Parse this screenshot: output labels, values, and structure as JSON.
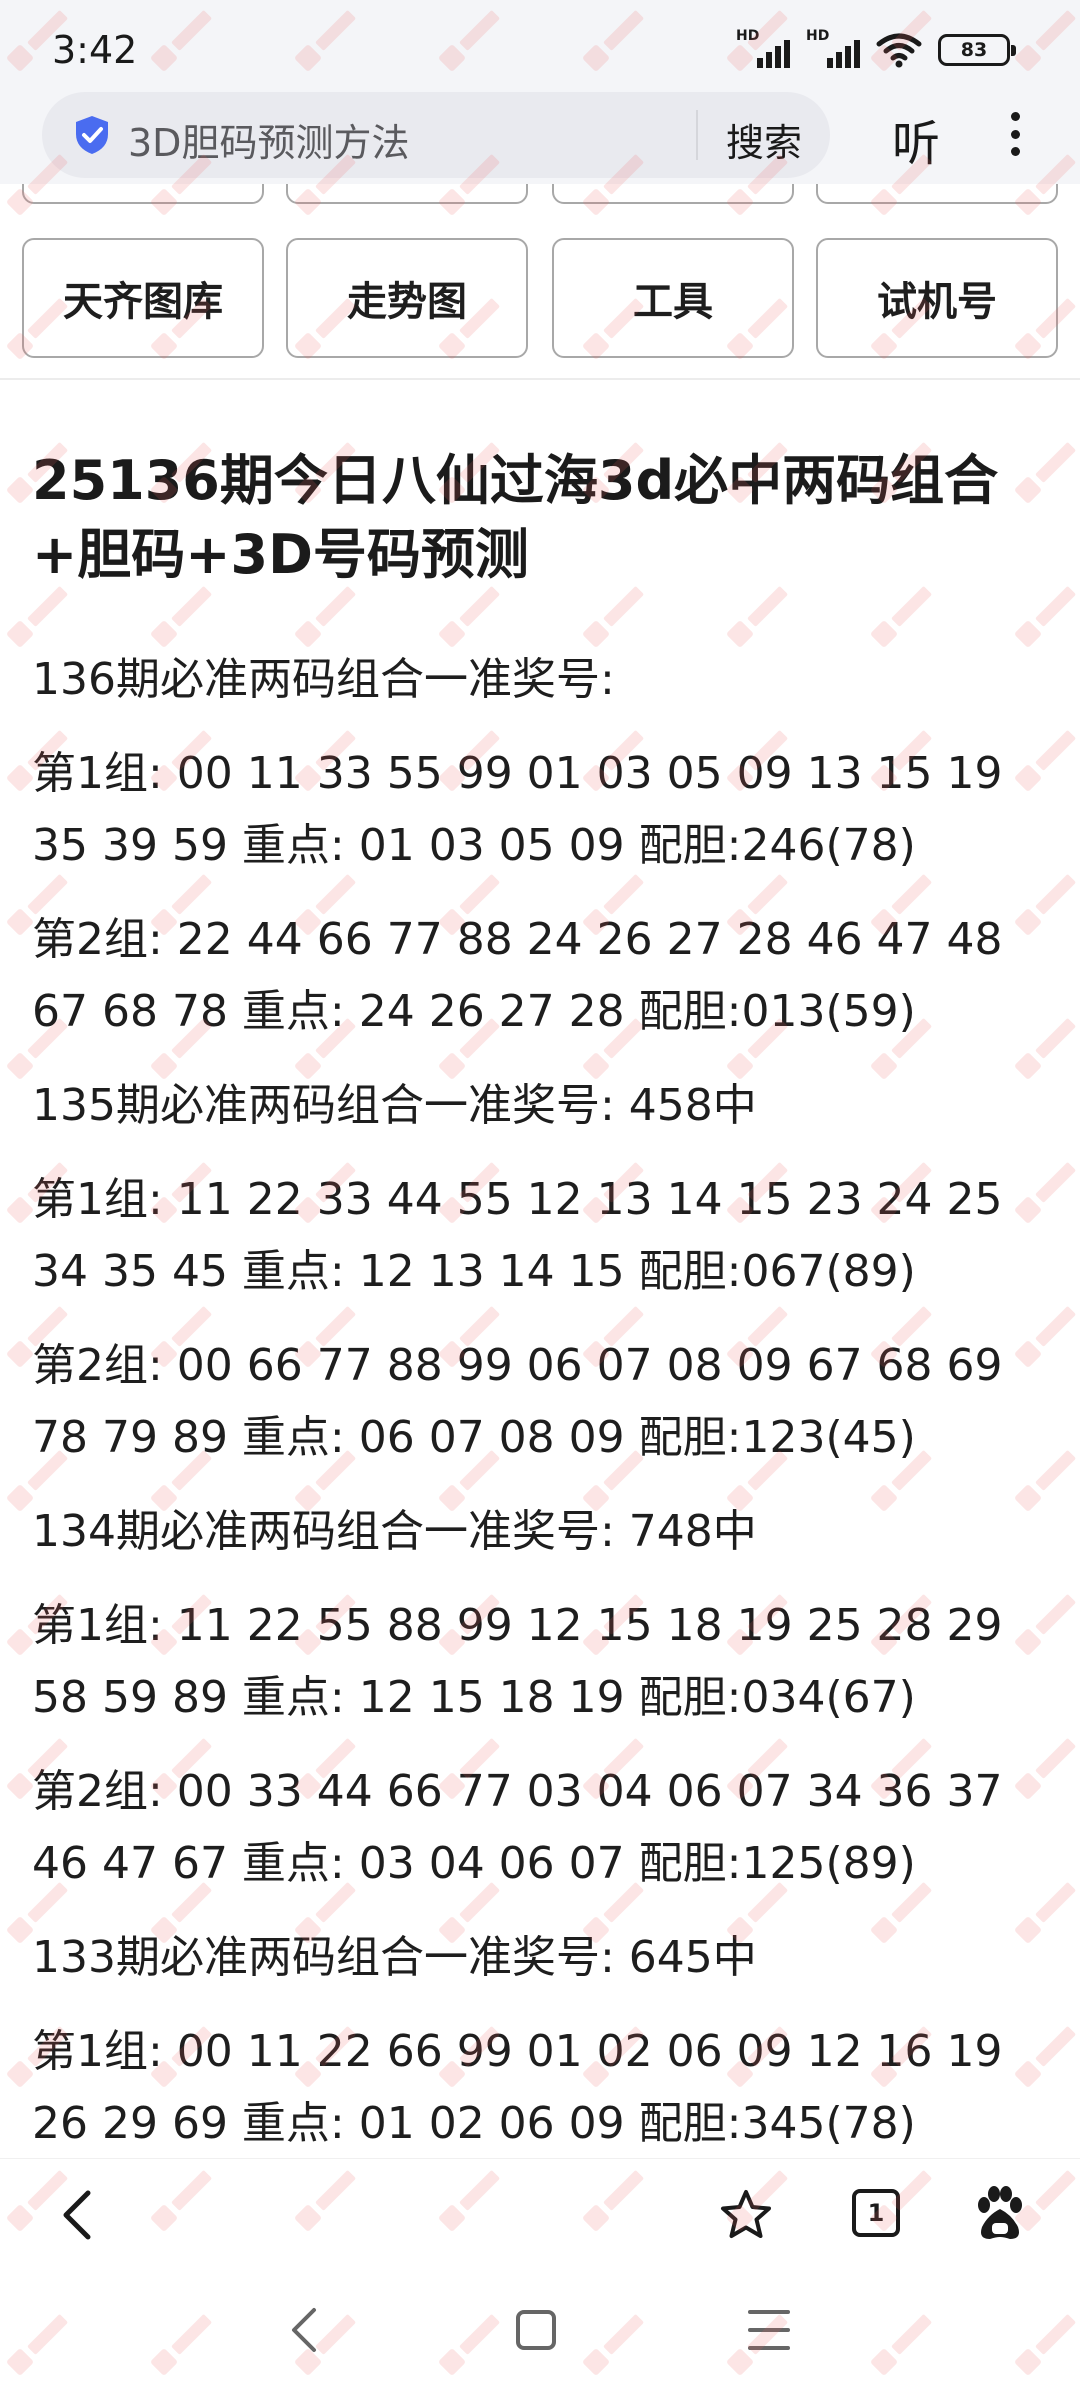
{
  "status_bar": {
    "time": "3:42",
    "signal_label": "HD",
    "battery": "83"
  },
  "browser": {
    "search_text": "3D胆码预测方法",
    "search_button": "搜索",
    "listen_button": "听"
  },
  "nav_buttons": [
    "天齐图库",
    "走势图",
    "工具",
    "试机号"
  ],
  "article": {
    "title": "25136期今日八仙过海3d必中两码组合+胆码+3D号码预测",
    "paragraphs": [
      "136期必准两码组合一准奖号:",
      "第1组: 00 11 33 55 99 01 03 05 09 13 15 19 35 39 59 重点: 01 03 05 09 配胆:246(78)",
      "第2组: 22 44 66 77 88 24 26 27 28 46 47 48 67 68 78 重点: 24 26 27 28 配胆:013(59)",
      "135期必准两码组合一准奖号: 458中",
      "第1组: 11 22 33 44 55 12 13 14 15 23 24 25 34 35 45 重点: 12 13 14 15 配胆:067(89)",
      "第2组: 00 66 77 88 99 06 07 08 09 67 68 69 78 79 89 重点: 06 07 08 09 配胆:123(45)",
      "134期必准两码组合一准奖号: 748中",
      "第1组: 11 22 55 88 99 12 15 18 19 25 28 29 58 59 89 重点: 12 15 18 19 配胆:034(67)",
      "第2组: 00 33 44 66 77 03 04 06 07 34 36 37 46 47 67 重点: 03 04 06 07 配胆:125(89)",
      "133期必准两码组合一准奖号: 645中",
      "第1组: 00 11 22 66 99 01 02 06 09 12 16 19 26 29 69 重点: 01 02 06 09 配胆:345(78)"
    ]
  },
  "toolbar": {
    "tab_count": "1"
  },
  "icons": {
    "shield": "shield-check-icon",
    "back": "back-chevron-icon",
    "star": "bookmark-star-icon",
    "tabs": "tabs-counter-icon",
    "baidu": "baidu-paw-icon"
  },
  "colors": {
    "shield_blue": "#4a6cf0",
    "watermark_red": "#e85a5a"
  }
}
